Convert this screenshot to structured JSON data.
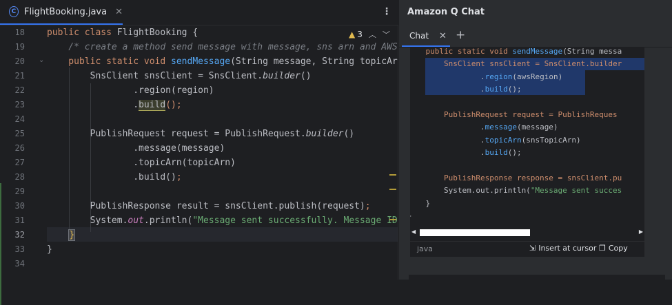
{
  "editor": {
    "tab_name": "FlightBooking.java",
    "tab_icon_letter": "C",
    "warning_count": "3",
    "line_numbers": [
      "18",
      "19",
      "20",
      "21",
      "22",
      "23",
      "24",
      "25",
      "26",
      "27",
      "28",
      "29",
      "30",
      "31",
      "32",
      "33",
      "34"
    ],
    "current_line": "32"
  },
  "code": {
    "l18_kw": "public class ",
    "l18_name": "FlightBooking {",
    "l19": "    /* create a method send message with message, sns arn and AWS R",
    "l20_kw": "    public static void ",
    "l20_fn": "sendMessage",
    "l20_rest": "(String message, String topicArn,",
    "l21_a": "        SnsClient snsClient = SnsClient.",
    "l21_b": "builder",
    "l21_c": "()",
    "l22": "                .region(region)",
    "l23_a": "                .",
    "l23_b": "build",
    "l23_c": "();",
    "l24": "",
    "l25_a": "        PublishRequest request = PublishRequest.",
    "l25_b": "builder",
    "l25_c": "()",
    "l26": "                .message(message)",
    "l27": "                .topicArn(topicArn)",
    "l28_a": "                .build()",
    "l28_b": ";",
    "l29": "",
    "l30_a": "        PublishResponse result = snsClient.publish(request)",
    "l30_b": ";",
    "l31_a": "        System.",
    "l31_b": "out",
    "l31_c": ".println(",
    "l31_d": "\"Message sent successfully. Message ID:",
    "l32": "    }",
    "l33": "}",
    "l34": ""
  },
  "q_panel": {
    "title": "Amazon Q Chat",
    "tab_label": "Chat",
    "snippet": {
      "s1_kw": "    public static void ",
      "s1_fn": "sendMessage",
      "s1_rest": "(String messa",
      "s2_a": "        SnsClient snsClient = SnsClient.",
      "s2_b": "builder",
      "s3_a": "                .",
      "s3_b": "region",
      "s3_c": "(awsRegion)",
      "s4_a": "                .",
      "s4_b": "build",
      "s4_c": "();",
      "s6_a": "        PublishRequest request = PublishReques",
      "s7_a": "                .",
      "s7_b": "message",
      "s7_c": "(message)",
      "s8_a": "                .",
      "s8_b": "topicArn",
      "s8_c": "(snsTopicArn)",
      "s9_a": "                .",
      "s9_b": "build",
      "s9_c": "();",
      "s11_a": "        PublishResponse response = snsClient.pu",
      "s12_a": "        System.out.println(",
      "s12_b": "\"Message sent succes",
      "s13": "    }",
      "s14": "}"
    },
    "language": "java",
    "insert_label": "Insert at cursor",
    "copy_label": "Copy"
  }
}
